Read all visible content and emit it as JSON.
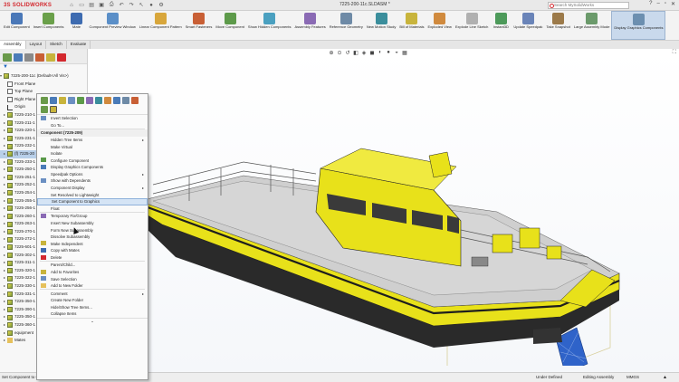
{
  "app": {
    "brand": "SOLIDWORKS",
    "document_title": "7225-200-11c.SLDASM *",
    "search_placeholder": "Search MySolidWorks"
  },
  "ribbon": [
    {
      "label": "Edit Component",
      "color": "#4a78b8"
    },
    {
      "label": "Insert Components",
      "color": "#6aa04a"
    },
    {
      "label": "Mate",
      "color": "#3d6bb0"
    },
    {
      "label": "Component Preview Window",
      "color": "#5b8fc8"
    },
    {
      "label": "Linear Component Pattern",
      "color": "#d8a63b"
    },
    {
      "label": "Smart Fasteners",
      "color": "#c85f35"
    },
    {
      "label": "Move Component",
      "color": "#5d9a4a"
    },
    {
      "label": "Show Hidden Components",
      "color": "#4aa0c0"
    },
    {
      "label": "Assembly Features",
      "color": "#8a6ab4"
    },
    {
      "label": "Reference Geometry",
      "color": "#6e8aa6"
    },
    {
      "label": "New Motion Study",
      "color": "#3b8e9c"
    },
    {
      "label": "Bill of Materials",
      "color": "#c8b43c"
    },
    {
      "label": "Exploded View",
      "color": "#d08a3e"
    },
    {
      "label": "Explode Line Sketch",
      "color": "#b0b0b0"
    },
    {
      "label": "Instant3D",
      "color": "#4d9a5a"
    },
    {
      "label": "Update Speedpak",
      "color": "#6a84b8"
    },
    {
      "label": "Take Snapshot",
      "color": "#9c7a4a"
    },
    {
      "label": "Large Assembly Mode",
      "color": "#6b9a6b"
    },
    {
      "label": "Display Graphics Components",
      "color": "#6c8fb0"
    }
  ],
  "cm_tabs": [
    "Assembly",
    "Layout",
    "Sketch",
    "Evaluate"
  ],
  "tree": {
    "filter_icon": "filter-icon",
    "root": "7225-200-11c (Default<All Vis>)",
    "items": [
      {
        "text": "Front Plane",
        "kind": "plane"
      },
      {
        "text": "Top Plane",
        "kind": "plane"
      },
      {
        "text": "Right Plane",
        "kind": "plane"
      },
      {
        "text": "Origin",
        "kind": "origin"
      },
      {
        "text": "7225-210-1",
        "kind": "comp"
      },
      {
        "text": "7225-211-1",
        "kind": "comp"
      },
      {
        "text": "7225-220-1",
        "kind": "comp"
      },
      {
        "text": "7225-231-1",
        "kind": "comp"
      },
      {
        "text": "7225-232-1",
        "kind": "comp"
      },
      {
        "text": "(f) 7225-20",
        "kind": "comp",
        "selected": true
      },
      {
        "text": "7225-233-1",
        "kind": "comp"
      },
      {
        "text": "7225-250-1",
        "kind": "comp"
      },
      {
        "text": "7225-251-1",
        "kind": "comp"
      },
      {
        "text": "7225-252-1",
        "kind": "comp"
      },
      {
        "text": "7225-254-1",
        "kind": "comp"
      },
      {
        "text": "7225-255-1",
        "kind": "comp"
      },
      {
        "text": "7225-256-1",
        "kind": "comp"
      },
      {
        "text": "7225-260-1",
        "kind": "comp"
      },
      {
        "text": "7225-263-1",
        "kind": "comp"
      },
      {
        "text": "7225-270-1",
        "kind": "comp"
      },
      {
        "text": "7225-272-1",
        "kind": "comp"
      },
      {
        "text": "7225-601-1",
        "kind": "comp"
      },
      {
        "text": "7225-302-1",
        "kind": "comp"
      },
      {
        "text": "7225-311-1",
        "kind": "comp"
      },
      {
        "text": "7225-320-1",
        "kind": "comp"
      },
      {
        "text": "7225-322-1",
        "kind": "comp"
      },
      {
        "text": "7225-330-1",
        "kind": "comp"
      },
      {
        "text": "7225-331-1",
        "kind": "comp"
      },
      {
        "text": "7225-350-1",
        "kind": "comp"
      },
      {
        "text": "7225-390-1",
        "kind": "comp"
      },
      {
        "text": "7225-350-1",
        "kind": "comp"
      },
      {
        "text": "7225-360-1",
        "kind": "comp"
      },
      {
        "text": "equipment",
        "kind": "comp"
      },
      {
        "text": "Mates",
        "kind": "folder"
      }
    ]
  },
  "context_menu": {
    "items": [
      {
        "text": "Invert Selection",
        "icon": "#6b8fc2"
      },
      {
        "text": "Go To...",
        "icon": ""
      },
      {
        "text": "Component (7225-209)",
        "header": true
      },
      {
        "text": "Hidden Tree Items",
        "sub": true
      },
      {
        "text": "Make Virtual",
        "icon": ""
      },
      {
        "text": "Isolate",
        "icon": ""
      },
      {
        "text": "Configure Component",
        "icon": "#5a9a4a"
      },
      {
        "text": "Display Graphics Components",
        "icon": "#4a7bb8"
      },
      {
        "text": "Speedpak Options",
        "sub": true
      },
      {
        "text": "Show with Dependents",
        "icon": "#6b8fc2"
      },
      {
        "text": "Component Display",
        "sub": true
      },
      {
        "text": "Set Resolved to Lightweight",
        "icon": ""
      },
      {
        "text": "Set Component to Graphics",
        "highlight": true
      },
      {
        "text": "Float",
        "icon": ""
      },
      {
        "text": "Temporary Fix/Group",
        "icon": "#8a6ab4"
      },
      {
        "text": "Insert New Subassembly",
        "icon": ""
      },
      {
        "text": "Form New Subassembly",
        "icon": ""
      },
      {
        "text": "Dissolve Subassembly",
        "icon": ""
      },
      {
        "text": "Make Independent",
        "icon": "#c8b43c"
      },
      {
        "text": "Copy with Mates",
        "icon": "#3d6bb0"
      },
      {
        "text": "Delete",
        "icon": "#d3282e"
      },
      {
        "text": "Parent/Child...",
        "icon": ""
      },
      {
        "text": "Add to Favorites",
        "icon": "#c8b43c"
      },
      {
        "text": "Save Selection",
        "icon": "#6b8fc2"
      },
      {
        "text": "Add to New Folder",
        "icon": "#e6c15c"
      },
      {
        "text": "Comment",
        "sub": true
      },
      {
        "text": "Create New Folder",
        "icon": ""
      },
      {
        "text": "Hide/Show Tree Items...",
        "icon": ""
      },
      {
        "text": "Collapse Items",
        "icon": ""
      }
    ],
    "more_indicator": " "
  },
  "status": {
    "left": "Set Component to Graphics",
    "under_defined": "Under Defined",
    "editing": "Editing Assembly",
    "units": "MMGS"
  },
  "colors": {
    "hull": "#e8e11a",
    "hull_dark": "#b7ad0c",
    "trim": "#1e1e1e",
    "deck": "#c8c8c8",
    "cage": "#2f63c9",
    "bbox": "#d8cf9a"
  }
}
